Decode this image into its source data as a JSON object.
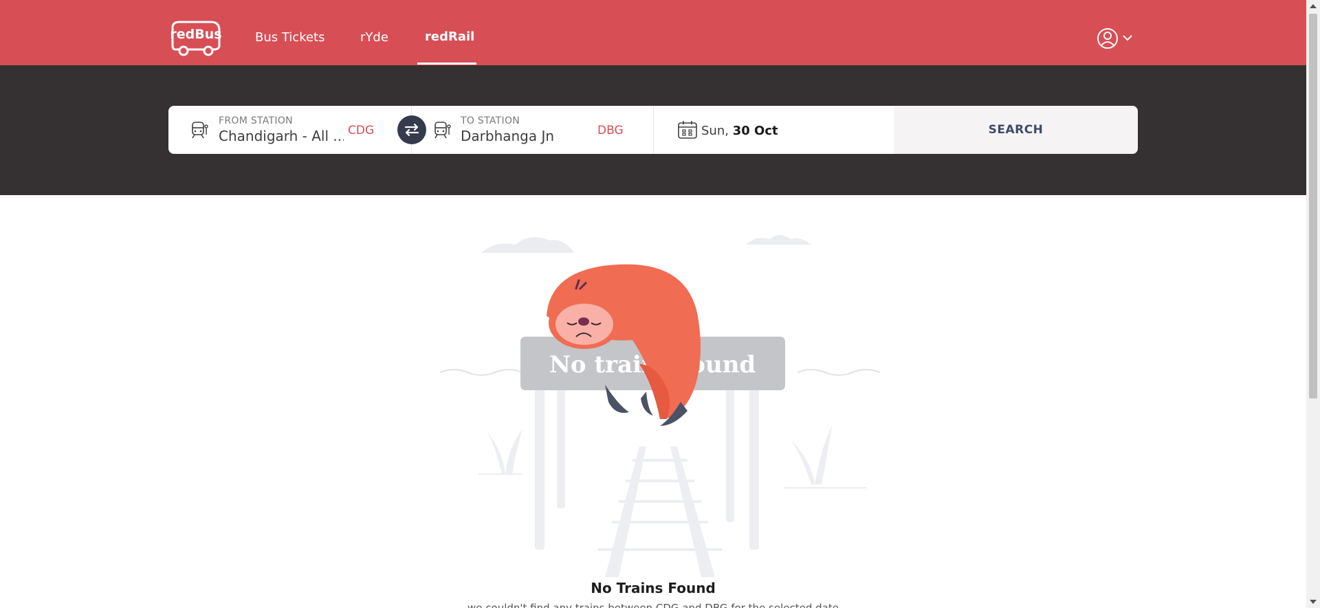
{
  "header": {
    "logo_text": "redBus",
    "nav": [
      {
        "label": "Bus Tickets",
        "active": false
      },
      {
        "label": "rYde",
        "active": false
      },
      {
        "label": "redRail",
        "active": true
      }
    ],
    "account_icon": "user-circle-icon",
    "brand_color": "#d84e55"
  },
  "search": {
    "from": {
      "label": "FROM STATION",
      "value": "Chandigarh - All ...",
      "code": "CDG"
    },
    "to": {
      "label": "TO STATION",
      "value": "Darbhanga Jn",
      "code": "DBG"
    },
    "date": {
      "day": "Sun,",
      "date": "30 Oct"
    },
    "button_label": "SEARCH"
  },
  "empty_state": {
    "board_text": "No trains found",
    "title": "No Trains Found",
    "subtitle": "we couldn't find any trains between CDG and DBG for the selected date"
  }
}
